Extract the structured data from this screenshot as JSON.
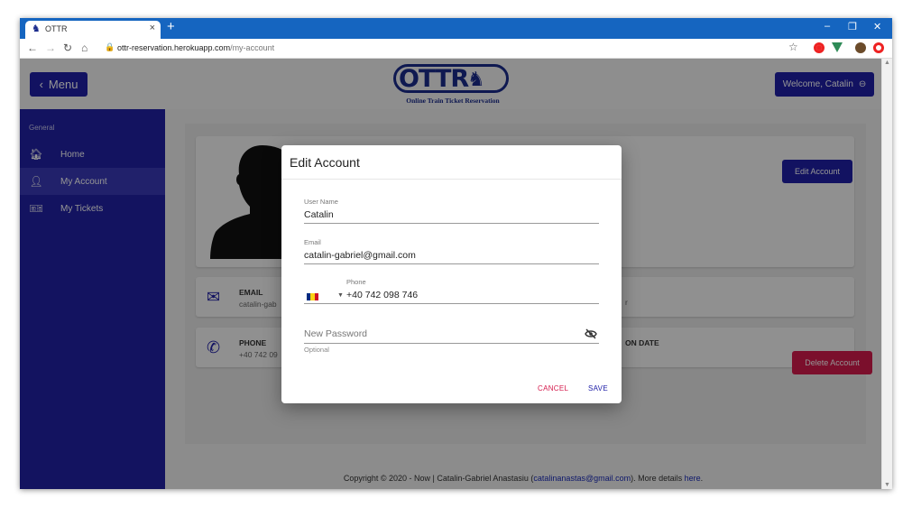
{
  "browser": {
    "tab_title": "OTTR",
    "tab_close": "×",
    "new_tab": "+",
    "url_host": "ottr-reservation.herokuapp.com",
    "url_path": "/my-account",
    "win_minimize": "–",
    "win_restore": "❐",
    "win_close": "✕"
  },
  "header": {
    "menu_label": "Menu",
    "welcome_label": "Welcome, Catalin",
    "logo_text": "OTTR",
    "logo_subtitle": "Online Train Ticket Reservation"
  },
  "sidebar": {
    "section": "General",
    "items": [
      {
        "label": "Home",
        "icon": "home-icon",
        "active": false
      },
      {
        "label": "My Account",
        "icon": "person-icon",
        "active": true
      },
      {
        "label": "My Tickets",
        "icon": "ticket-icon",
        "active": false
      }
    ]
  },
  "account": {
    "edit_button": "Edit Account",
    "delete_button": "Delete Account",
    "email_label": "EMAIL",
    "email_value": "catalin-gab",
    "phone_label": "PHONE",
    "phone_value": "+40 742 09",
    "right_partial_1": "r",
    "right_partial_2": "ON DATE"
  },
  "footer": {
    "prefix": "Copyright © 2020 - Now | Catalin-Gabriel Anastasiu (",
    "email": "catalinanastas@gmail.com",
    "middle": "). More details ",
    "link": "here",
    "suffix": "."
  },
  "modal": {
    "title": "Edit Account",
    "username_label": "User Name",
    "username_value": "Catalin",
    "email_label": "Email",
    "email_value": "catalin-gabriel@gmail.com",
    "phone_label": "Phone",
    "phone_value": "+40 742 098 746",
    "password_placeholder": "New Password",
    "password_hint": "Optional",
    "cancel_label": "CANCEL",
    "save_label": "SAVE"
  },
  "colors": {
    "primary": "#2020a8",
    "sidebar": "#2222a6",
    "danger": "#d51a4c",
    "browser_frame": "#1565c0"
  }
}
